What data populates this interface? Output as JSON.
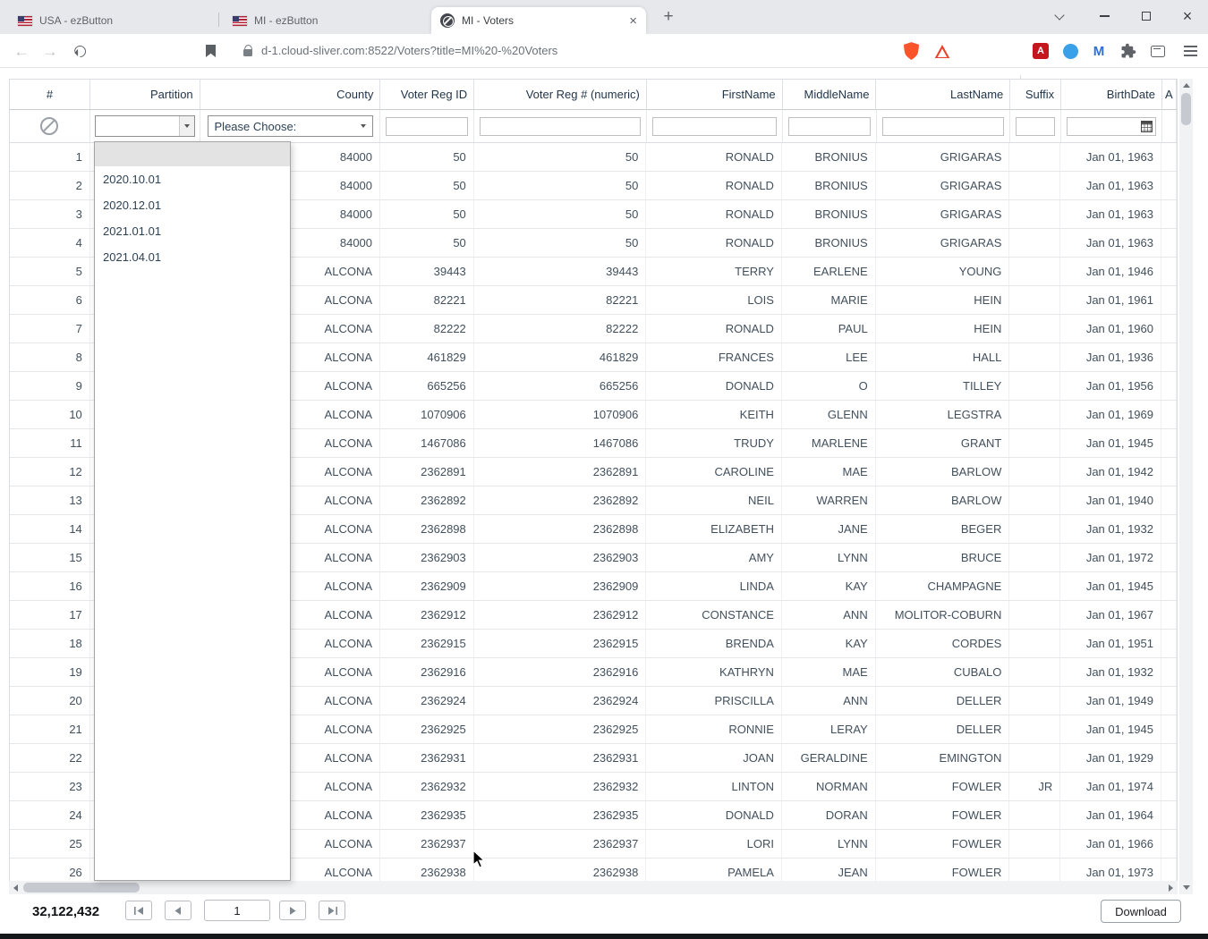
{
  "browser": {
    "tabs": [
      {
        "title": "USA - ezButton",
        "active": false
      },
      {
        "title": "MI - ezButton",
        "active": false
      },
      {
        "title": "MI - Voters",
        "active": true
      }
    ],
    "url": "d-1.cloud-sliver.com:8522/Voters?title=MI%20-%20Voters"
  },
  "icons": {
    "new_tab": "+",
    "tab_close": "×",
    "window_close": "×",
    "back_arrow": "←",
    "forward_arrow": "→",
    "pdf_label": "A",
    "m_label": "M"
  },
  "grid": {
    "columns": [
      "#",
      "Partition",
      "County",
      "Voter Reg ID",
      "Voter Reg # (numeric)",
      "FirstName",
      "MiddleName",
      "LastName",
      "Suffix",
      "BirthDate",
      "A"
    ],
    "filters": {
      "county_placeholder": "Please Choose:"
    },
    "rows": [
      [
        "1",
        "",
        "84000",
        "50",
        "50",
        "RONALD",
        "BRONIUS",
        "GRIGARAS",
        "",
        "Jan 01, 1963",
        ""
      ],
      [
        "2",
        "",
        "84000",
        "50",
        "50",
        "RONALD",
        "BRONIUS",
        "GRIGARAS",
        "",
        "Jan 01, 1963",
        ""
      ],
      [
        "3",
        "",
        "84000",
        "50",
        "50",
        "RONALD",
        "BRONIUS",
        "GRIGARAS",
        "",
        "Jan 01, 1963",
        ""
      ],
      [
        "4",
        "",
        "84000",
        "50",
        "50",
        "RONALD",
        "BRONIUS",
        "GRIGARAS",
        "",
        "Jan 01, 1963",
        ""
      ],
      [
        "5",
        "",
        "ALCONA",
        "39443",
        "39443",
        "TERRY",
        "EARLENE",
        "YOUNG",
        "",
        "Jan 01, 1946",
        ""
      ],
      [
        "6",
        "",
        "ALCONA",
        "82221",
        "82221",
        "LOIS",
        "MARIE",
        "HEIN",
        "",
        "Jan 01, 1961",
        ""
      ],
      [
        "7",
        "",
        "ALCONA",
        "82222",
        "82222",
        "RONALD",
        "PAUL",
        "HEIN",
        "",
        "Jan 01, 1960",
        ""
      ],
      [
        "8",
        "",
        "ALCONA",
        "461829",
        "461829",
        "FRANCES",
        "LEE",
        "HALL",
        "",
        "Jan 01, 1936",
        ""
      ],
      [
        "9",
        "",
        "ALCONA",
        "665256",
        "665256",
        "DONALD",
        "O",
        "TILLEY",
        "",
        "Jan 01, 1956",
        ""
      ],
      [
        "10",
        "",
        "ALCONA",
        "1070906",
        "1070906",
        "KEITH",
        "GLENN",
        "LEGSTRA",
        "",
        "Jan 01, 1969",
        ""
      ],
      [
        "11",
        "",
        "ALCONA",
        "1467086",
        "1467086",
        "TRUDY",
        "MARLENE",
        "GRANT",
        "",
        "Jan 01, 1945",
        ""
      ],
      [
        "12",
        "",
        "ALCONA",
        "2362891",
        "2362891",
        "CAROLINE",
        "MAE",
        "BARLOW",
        "",
        "Jan 01, 1942",
        ""
      ],
      [
        "13",
        "",
        "ALCONA",
        "2362892",
        "2362892",
        "NEIL",
        "WARREN",
        "BARLOW",
        "",
        "Jan 01, 1940",
        ""
      ],
      [
        "14",
        "",
        "ALCONA",
        "2362898",
        "2362898",
        "ELIZABETH",
        "JANE",
        "BEGER",
        "",
        "Jan 01, 1932",
        ""
      ],
      [
        "15",
        "",
        "ALCONA",
        "2362903",
        "2362903",
        "AMY",
        "LYNN",
        "BRUCE",
        "",
        "Jan 01, 1972",
        ""
      ],
      [
        "16",
        "",
        "ALCONA",
        "2362909",
        "2362909",
        "LINDA",
        "KAY",
        "CHAMPAGNE",
        "",
        "Jan 01, 1945",
        ""
      ],
      [
        "17",
        "",
        "ALCONA",
        "2362912",
        "2362912",
        "CONSTANCE",
        "ANN",
        "MOLITOR-COBURN",
        "",
        "Jan 01, 1967",
        ""
      ],
      [
        "18",
        "",
        "ALCONA",
        "2362915",
        "2362915",
        "BRENDA",
        "KAY",
        "CORDES",
        "",
        "Jan 01, 1951",
        ""
      ],
      [
        "19",
        "",
        "ALCONA",
        "2362916",
        "2362916",
        "KATHRYN",
        "MAE",
        "CUBALO",
        "",
        "Jan 01, 1932",
        ""
      ],
      [
        "20",
        "",
        "ALCONA",
        "2362924",
        "2362924",
        "PRISCILLA",
        "ANN",
        "DELLER",
        "",
        "Jan 01, 1949",
        ""
      ],
      [
        "21",
        "",
        "ALCONA",
        "2362925",
        "2362925",
        "RONNIE",
        "LERAY",
        "DELLER",
        "",
        "Jan 01, 1945",
        ""
      ],
      [
        "22",
        "",
        "ALCONA",
        "2362931",
        "2362931",
        "JOAN",
        "GERALDINE",
        "EMINGTON",
        "",
        "Jan 01, 1929",
        ""
      ],
      [
        "23",
        "",
        "ALCONA",
        "2362932",
        "2362932",
        "LINTON",
        "NORMAN",
        "FOWLER",
        "JR",
        "Jan 01, 1974",
        ""
      ],
      [
        "24",
        "",
        "ALCONA",
        "2362935",
        "2362935",
        "DONALD",
        "DORAN",
        "FOWLER",
        "",
        "Jan 01, 1964",
        ""
      ],
      [
        "25",
        "",
        "ALCONA",
        "2362937",
        "2362937",
        "LORI",
        "LYNN",
        "FOWLER",
        "",
        "Jan 01, 1966",
        ""
      ],
      [
        "26",
        "",
        "ALCONA",
        "2362938",
        "2362938",
        "PAMELA",
        "JEAN",
        "FOWLER",
        "",
        "Jan 01, 1973",
        ""
      ]
    ]
  },
  "partition_dropdown": {
    "options": [
      "",
      "2020.10.01",
      "2020.12.01",
      "2021.01.01",
      "2021.04.01"
    ]
  },
  "footer": {
    "total": "32,122,432",
    "page": "1",
    "download_label": "Download"
  }
}
